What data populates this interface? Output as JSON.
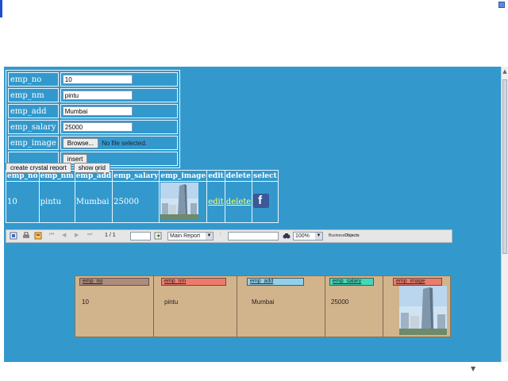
{
  "colors": {
    "page_bg": "#3399cc",
    "report_bg": "#d2b48c",
    "link": "#ffff66"
  },
  "form": {
    "fields": [
      {
        "label": "emp_no",
        "value": "10"
      },
      {
        "label": "emp_nm",
        "value": "pintu"
      },
      {
        "label": "emp_add",
        "value": "Mumbai"
      },
      {
        "label": "emp_salary",
        "value": "25000"
      }
    ],
    "image_label": "emp_image",
    "browse_label": "Browse...",
    "file_status": "No file selected.",
    "insert_label": "insert"
  },
  "actions": {
    "crystal_label": "create crystal report",
    "grid_label": "show grid"
  },
  "grid": {
    "columns": [
      "emp_no",
      "emp_nm",
      "emp_add",
      "emp_salary",
      "emp_image",
      "edit",
      "delete",
      "select"
    ],
    "row": {
      "emp_no": "10",
      "emp_nm": "pintu",
      "emp_add": "Mumbai",
      "emp_salary": "25000",
      "edit": "edit",
      "delete": "delete",
      "select_icon": "facebook-icon"
    }
  },
  "toolbar": {
    "page_indicator": "1 / 1",
    "goto_value": "",
    "view_select": "Main Report",
    "search_value": "",
    "zoom": "100%",
    "brand_line1": "Business",
    "brand_line2": "Objects"
  },
  "report": {
    "headers": [
      {
        "text": "emp_no",
        "color": "#b08a7a"
      },
      {
        "text": "emp_nm",
        "color": "#f07a6a"
      },
      {
        "text": "emp_add",
        "color": "#8fd0ec"
      },
      {
        "text": "emp_salary",
        "color": "#40d8b8"
      },
      {
        "text": "emp_image",
        "color": "#f07a6a"
      }
    ],
    "values": [
      "10",
      "pintu",
      "Mumbai",
      "25000"
    ]
  }
}
